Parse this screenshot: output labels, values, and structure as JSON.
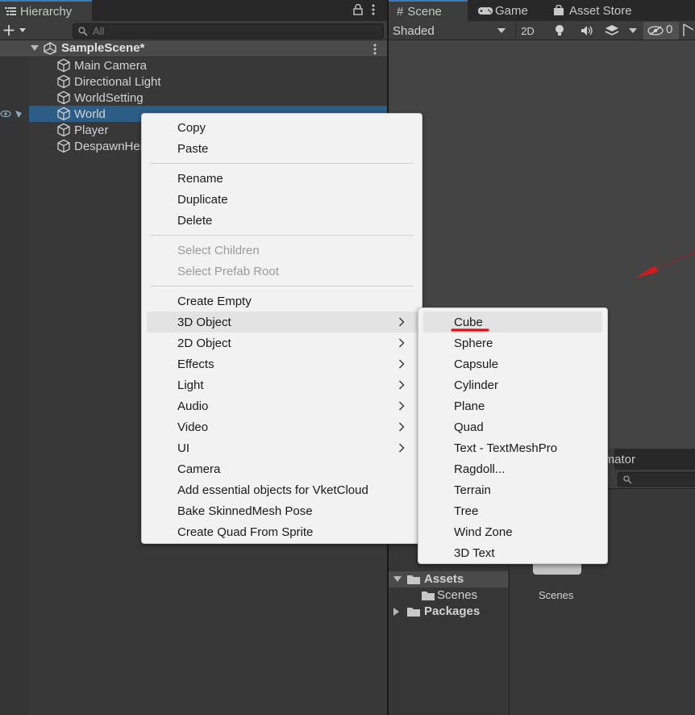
{
  "hierarchy": {
    "tab_label": "Hierarchy",
    "search_placeholder": "All",
    "scene_name": "SampleScene*",
    "items": [
      {
        "label": "Main Camera"
      },
      {
        "label": "Directional Light"
      },
      {
        "label": "WorldSetting"
      },
      {
        "label": "World",
        "selected": true
      },
      {
        "label": "Player"
      },
      {
        "label": "DespawnHeight"
      }
    ]
  },
  "scene_view": {
    "tabs": [
      {
        "label": "Scene",
        "icon": "grid-icon",
        "active": true
      },
      {
        "label": "Game",
        "icon": "gamepad-icon"
      },
      {
        "label": "Asset Store",
        "icon": "store-bag-icon"
      }
    ],
    "shading_mode": "Shaded",
    "toggle_2d": "2D",
    "hidden_count": "0"
  },
  "bottom_panel": {
    "tab_partial": "nimator",
    "assets_label": "Assets",
    "scenes_label": "Scenes",
    "packages_label": "Packages",
    "folder_tile_label": "Scenes"
  },
  "context_menu": {
    "groups": [
      [
        {
          "label": "Copy"
        },
        {
          "label": "Paste"
        }
      ],
      [
        {
          "label": "Rename"
        },
        {
          "label": "Duplicate"
        },
        {
          "label": "Delete"
        }
      ],
      [
        {
          "label": "Select Children",
          "disabled": true
        },
        {
          "label": "Select Prefab Root",
          "disabled": true
        }
      ],
      [
        {
          "label": "Create Empty"
        },
        {
          "label": "3D Object",
          "submenu": true,
          "highlighted": true
        },
        {
          "label": "2D Object",
          "submenu": true
        },
        {
          "label": "Effects",
          "submenu": true
        },
        {
          "label": "Light",
          "submenu": true
        },
        {
          "label": "Audio",
          "submenu": true
        },
        {
          "label": "Video",
          "submenu": true
        },
        {
          "label": "UI",
          "submenu": true
        },
        {
          "label": "Camera"
        },
        {
          "label": "Add essential objects for VketCloud"
        },
        {
          "label": "Bake SkinnedMesh Pose"
        },
        {
          "label": "Create Quad From Sprite"
        }
      ]
    ]
  },
  "submenu_3d": {
    "items": [
      {
        "label": "Cube",
        "highlighted": true,
        "underline_color": "#e01010"
      },
      {
        "label": "Sphere"
      },
      {
        "label": "Capsule"
      },
      {
        "label": "Cylinder"
      },
      {
        "label": "Plane"
      },
      {
        "label": "Quad"
      },
      {
        "label": "Text - TextMeshPro"
      },
      {
        "label": "Ragdoll..."
      },
      {
        "label": "Terrain"
      },
      {
        "label": "Tree"
      },
      {
        "label": "Wind Zone"
      },
      {
        "label": "3D Text"
      }
    ]
  },
  "colors": {
    "selection": "#2c5d87",
    "tab_accent": "#3a79bb",
    "menu_bg": "#f2f2f2",
    "gizmo_red": "#d61a1a"
  }
}
